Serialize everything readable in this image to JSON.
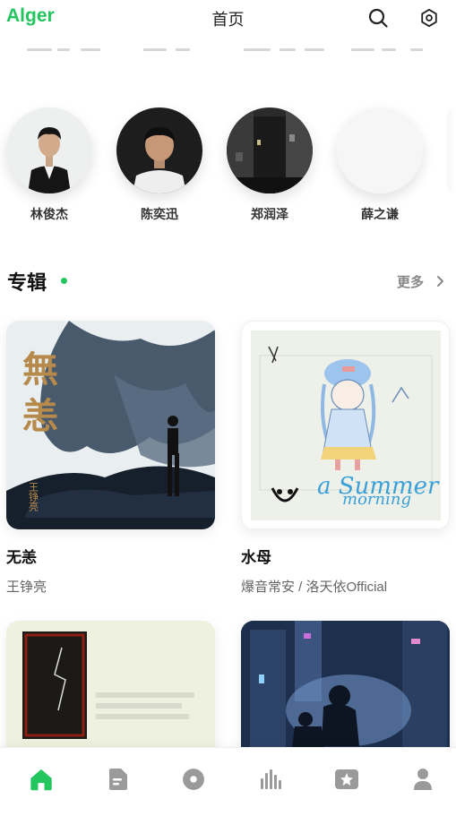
{
  "header": {
    "logo": "Alger",
    "title": "首页",
    "search_icon": "search-icon",
    "settings_icon": "gear-icon"
  },
  "artists": [
    {
      "name": "林俊杰"
    },
    {
      "name": "陈奕迅"
    },
    {
      "name": "郑润泽"
    },
    {
      "name": "薛之谦"
    }
  ],
  "album_section": {
    "title": "专辑",
    "more_label": "更多"
  },
  "albums": [
    {
      "title": "无恙",
      "artist": "王铮亮",
      "cover_text": [
        "無",
        "恙"
      ],
      "cover_small": "王铮亮"
    },
    {
      "title": "水母",
      "artist": "爆音常安 / 洛天依Official",
      "cover_text": [
        "a Summer",
        "morning"
      ]
    },
    {
      "title": "",
      "artist": ""
    },
    {
      "title": "",
      "artist": ""
    }
  ],
  "bottom_nav": [
    {
      "name": "home-icon",
      "active": true
    },
    {
      "name": "document-icon",
      "active": false
    },
    {
      "name": "disc-icon",
      "active": false
    },
    {
      "name": "chart-bars-icon",
      "active": false
    },
    {
      "name": "star-box-icon",
      "active": false
    },
    {
      "name": "user-icon",
      "active": false
    }
  ],
  "colors": {
    "accent": "#22c55e",
    "nav_inactive": "#9a9a9a",
    "text_secondary": "#666666"
  }
}
